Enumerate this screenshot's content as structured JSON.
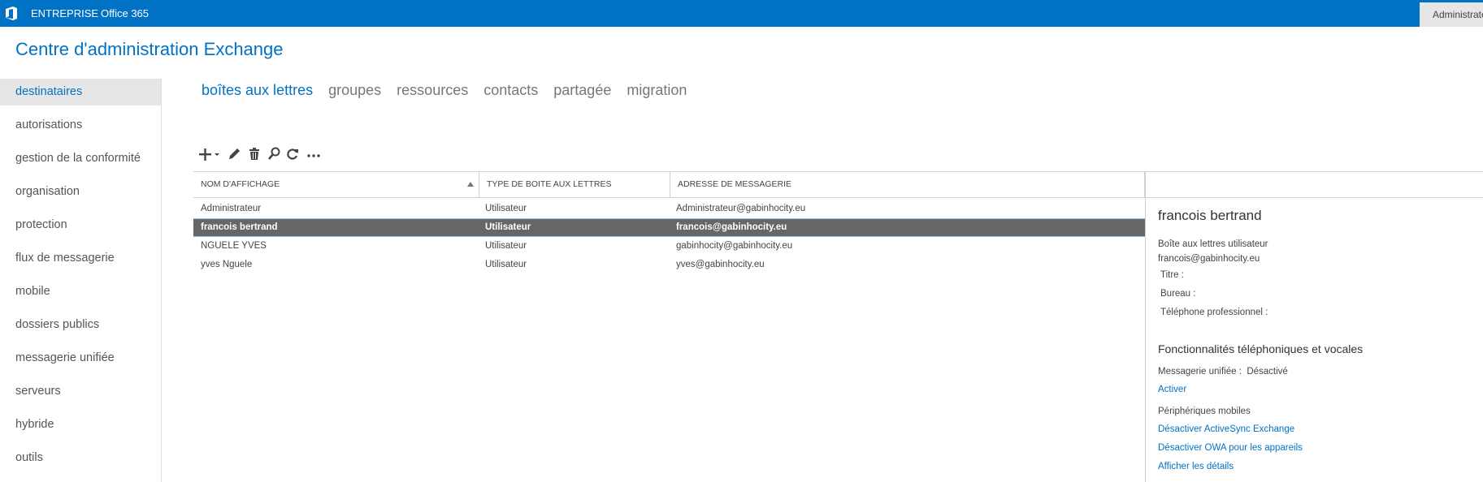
{
  "topbar": {
    "brand": "ENTREPRISE",
    "product": "Office 365",
    "user": "Administrateur",
    "logo_icon": "office-logo-icon",
    "color": "#0072c6"
  },
  "app_title": "Centre d'administration Exchange",
  "nav": {
    "items": [
      {
        "label": "destinataires",
        "selected": true
      },
      {
        "label": "autorisations"
      },
      {
        "label": "gestion de la conformité"
      },
      {
        "label": "organisation"
      },
      {
        "label": "protection"
      },
      {
        "label": "flux de messagerie"
      },
      {
        "label": "mobile"
      },
      {
        "label": "dossiers publics"
      },
      {
        "label": "messagerie unifiée"
      },
      {
        "label": "serveurs"
      },
      {
        "label": "hybride"
      },
      {
        "label": "outils"
      }
    ]
  },
  "tabs": [
    {
      "label": "boîtes aux lettres",
      "active": true
    },
    {
      "label": "groupes"
    },
    {
      "label": "ressources"
    },
    {
      "label": "contacts"
    },
    {
      "label": "partagée"
    },
    {
      "label": "migration"
    }
  ],
  "toolbar": {
    "icons": [
      "add-icon",
      "edit-icon",
      "delete-icon",
      "search-icon",
      "refresh-icon",
      "more-icon"
    ]
  },
  "grid": {
    "columns": [
      "NOM D'AFFICHAGE",
      "TYPE DE BOITE AUX LETTRES",
      "ADRESSE DE MESSAGERIE"
    ],
    "sort_column": "NOM D'AFFICHAGE",
    "sort_direction": "ascending",
    "rows": [
      {
        "name": "Administrateur",
        "type": "Utilisateur",
        "email": "Administrateur@gabinhocity.eu"
      },
      {
        "name": "francois bertrand",
        "type": "Utilisateur",
        "email": "francois@gabinhocity.eu",
        "selected": true
      },
      {
        "name": "NGUELE YVES",
        "type": "Utilisateur",
        "email": "gabinhocity@gabinhocity.eu"
      },
      {
        "name": "yves Nguele",
        "type": "Utilisateur",
        "email": "yves@gabinhocity.eu"
      }
    ]
  },
  "details": {
    "name": "francois bertrand",
    "mailbox_type": "Boîte aux lettres utilisateur",
    "email": "francois@gabinhocity.eu",
    "title_label": "Titre :",
    "office_label": "Bureau :",
    "phone_label": "Téléphone professionnel :",
    "voice_section": "Fonctionnalités téléphoniques et vocales",
    "um_label": "Messagerie unifiée :",
    "um_value": "Désactivé",
    "enable_link": "Activer",
    "mobile_section": "Périphériques mobiles",
    "disable_activesync": "Désactiver ActiveSync Exchange",
    "disable_owa": "Désactiver OWA pour les appareils",
    "show_details": "Afficher les détails"
  }
}
